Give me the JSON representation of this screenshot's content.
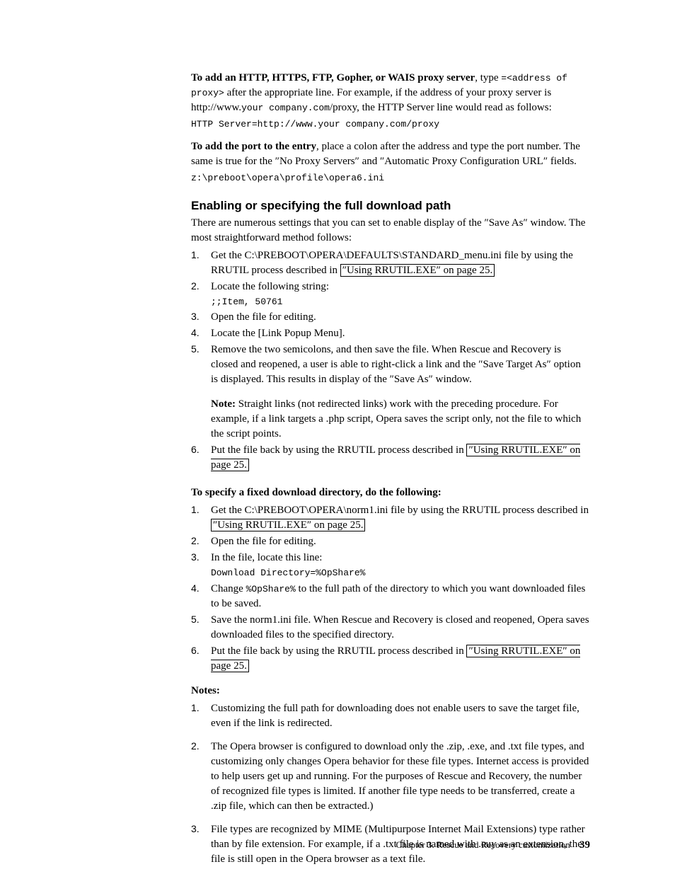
{
  "intro1": {
    "lead": "To add an HTTP, HTTPS, FTP, Gopher, or WAIS proxy server",
    "t1": ", type ",
    "m1": "=<address of proxy>",
    "t2": " after the appropriate line. For example, if the address of your proxy server is http://www.",
    "m2": "your company.com",
    "t3": "/proxy, the HTTP Server line would read as follows:"
  },
  "code1": "HTTP Server=http://www.your company.com/proxy",
  "intro2": {
    "lead": "To add the port to the entry",
    "t1": ", place a colon after the address and type the port number. The same is true for the ″No Proxy Servers″ and ″Automatic Proxy Configuration URL″ fields."
  },
  "code2": "z:\\preboot\\opera\\profile\\opera6.ini",
  "section_heading": "Enabling or specifying the full download path",
  "section_intro": "There are numerous settings that you can set to enable display of the ″Save As″ window. The most straightforward method follows:",
  "olA": {
    "i1a": "Get the C:\\PREBOOT\\OPERA\\DEFAULTS\\STANDARD_menu.ini file by using the RRUTIL process described in ",
    "i1link": "″Using RRUTIL.EXE″ on page 25.",
    "i2a": "Locate the following string:",
    "i2code": ";;Item, 50761",
    "i3": "Open the file for editing.",
    "i4": "Locate the [Link Popup Menu].",
    "i5a": "Remove the two semicolons, and then save the file. When Rescue and Recovery is closed and reopened, a user is able to right-click a link and the ″Save Target As″ option is displayed. This results in display of the ″Save As″ window.",
    "i5note_lead": "Note:",
    "i5note": "  Straight links (not redirected links) work with the preceding procedure. For example, if a link targets a .php script, Opera saves the script only, not the file to which the script points.",
    "i6a": "Put the file back by using the RRUTIL process described in ",
    "i6link": "″Using RRUTIL.EXE″ on page 25."
  },
  "subhead": "To specify a fixed download directory, do the following:",
  "olB": {
    "i1a": "Get the C:\\PREBOOT\\OPERA\\norm1.ini file by using the RRUTIL process described in ",
    "i1link": "″Using RRUTIL.EXE″ on page 25.",
    "i2": "Open the file for editing.",
    "i3a": "In the file, locate this line:",
    "i3code": "Download Directory=%OpShare%",
    "i4a": "Change ",
    "i4m": "%OpShare%",
    "i4b": " to the full path of the directory to which you want downloaded files to be saved.",
    "i5": "Save the norm1.ini file. When Rescue and Recovery is closed and reopened, Opera saves downloaded files to the specified directory.",
    "i6a": "Put the file back by using the RRUTIL process described in ",
    "i6link": "″Using RRUTIL.EXE″ on page 25."
  },
  "notes_head": "Notes:",
  "notes": {
    "n1": "Customizing the full path for downloading does not enable users to save the target file, even if the link is redirected.",
    "n2": "The Opera browser is configured to download only the .zip, .exe, and .txt file types, and customizing only changes Opera behavior for these file types. Internet access is provided to help users get up and running. For the purposes of Rescue and Recovery, the number of recognized file types is limited. If another file type needs to be transferred, create a .zip file, which can then be extracted.)",
    "n3": "File types are recognized by MIME (Multipurpose Internet Mail Extensions) type rather than by file extension. For example, if a .txt file is named with .euy as an extension, the file is still open in the Opera browser as a text file."
  },
  "footer_chapter": "Chapter 3. Rescue and Recovery customization",
  "footer_page": "39"
}
